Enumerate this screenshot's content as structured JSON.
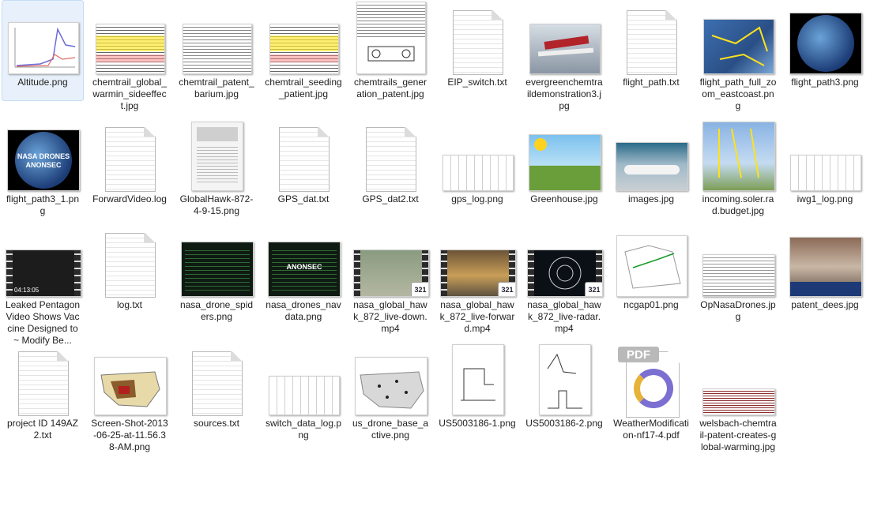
{
  "items": [
    {
      "label": "Altitude.png",
      "kind": "chart",
      "selected": true
    },
    {
      "label": "chemtrail_global_warmin_sideeffect.jpg",
      "kind": "scan-yellow"
    },
    {
      "label": "chemtrail_patent_barium.jpg",
      "kind": "patent"
    },
    {
      "label": "chemtrail_seeding_patient.jpg",
      "kind": "scan-yellow"
    },
    {
      "label": "chemtrails_generation_patent.jpg",
      "kind": "patent-tall"
    },
    {
      "label": "EIP_switch.txt",
      "kind": "txt"
    },
    {
      "label": "evergreenchemtraildemonstration3.jpg",
      "kind": "plane-red"
    },
    {
      "label": "flight_path.txt",
      "kind": "txt"
    },
    {
      "label": "flight_path_full_zoom_eastcoast.png",
      "kind": "map-blue"
    },
    {
      "label": "flight_path3.png",
      "kind": "globe"
    },
    {
      "label": "flight_path3_1.png",
      "kind": "globe-nasa"
    },
    {
      "label": "ForwardVideo.log",
      "kind": "txt"
    },
    {
      "label": "GlobalHawk-872-4-9-15.png",
      "kind": "doc-gray"
    },
    {
      "label": "GPS_dat.txt",
      "kind": "txt"
    },
    {
      "label": "GPS_dat2.txt",
      "kind": "txt"
    },
    {
      "label": "gps_log.png",
      "kind": "table"
    },
    {
      "label": "Greenhouse.jpg",
      "kind": "greenhouse"
    },
    {
      "label": "images.jpg",
      "kind": "evergreen"
    },
    {
      "label": "incoming.soler.rad.budget.jpg",
      "kind": "budget"
    },
    {
      "label": "iwg1_log.png",
      "kind": "table"
    },
    {
      "label": "Leaked Pentagon Video Shows Vaccine Designed to ~ Modify Be...",
      "kind": "video-dark"
    },
    {
      "label": "log.txt",
      "kind": "txt"
    },
    {
      "label": "nasa_drone_spiders.png",
      "kind": "screen-dark"
    },
    {
      "label": "nasa_drones_navdata.png",
      "kind": "screen-anon"
    },
    {
      "label": "nasa_global_hawk_872_live-down.mp4",
      "kind": "video-aerial"
    },
    {
      "label": "nasa_global_hawk_872_live-forward.mp4",
      "kind": "video-sky"
    },
    {
      "label": "nasa_global_hawk_872_live-radar.mp4",
      "kind": "video-radar"
    },
    {
      "label": "ncgap01.png",
      "kind": "ncgap"
    },
    {
      "label": "OpNasaDrones.jpg",
      "kind": "text-page"
    },
    {
      "label": "patent_dees.jpg",
      "kind": "patent-photo"
    },
    {
      "label": "project ID 149AZ2.txt",
      "kind": "txt"
    },
    {
      "label": "Screen-Shot-2013-06-25-at-11.56.38-AM.png",
      "kind": "usmap-drought"
    },
    {
      "label": "sources.txt",
      "kind": "txt"
    },
    {
      "label": "switch_data_log.png",
      "kind": "table-small"
    },
    {
      "label": "us_drone_base_active.png",
      "kind": "usmap-drone"
    },
    {
      "label": "US5003186-1.png",
      "kind": "diagram"
    },
    {
      "label": "US5003186-2.png",
      "kind": "diagram2"
    },
    {
      "label": "WeatherModification-nf17-4.pdf",
      "kind": "pdf"
    },
    {
      "label": "welsbach-chemtrail-patent-creates-global-warming.jpg",
      "kind": "text-small"
    }
  ],
  "icon_text": {
    "pdf": "PDF",
    "badge": "321",
    "nasa_drones": "NASA DRONES",
    "anonsec": "ANONSEC",
    "timecode": "04:13:05"
  },
  "colors": {
    "selected_bg": "#e8f1fb",
    "selected_border": "#c4dcf5"
  }
}
